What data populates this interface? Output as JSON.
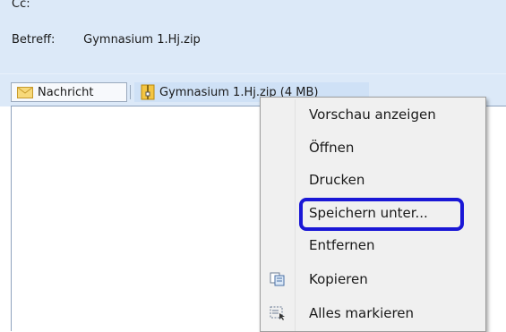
{
  "header": {
    "cc_label": "Cc:",
    "subject_label": "Betreff:",
    "subject_value": "Gymnasium 1.Hj.zip"
  },
  "attachments": {
    "message_tab": "Nachricht",
    "zip_tab": "Gymnasium 1.Hj.zip (4 MB)"
  },
  "context_menu": {
    "items": [
      {
        "label": "Vorschau anzeigen",
        "icon": ""
      },
      {
        "label": "Öffnen",
        "icon": ""
      },
      {
        "label": "Drucken",
        "icon": ""
      },
      {
        "label": "Speichern unter...",
        "icon": "",
        "highlighted": true
      },
      {
        "label": "Entfernen",
        "icon": ""
      },
      {
        "label": "Kopieren",
        "icon": "copy-icon"
      },
      {
        "label": "Alles markieren",
        "icon": "select-all-icon"
      }
    ]
  },
  "colors": {
    "header_bg": "#dce9f8",
    "highlight_border": "#1a17d6",
    "menu_bg": "#f0f0f0"
  }
}
